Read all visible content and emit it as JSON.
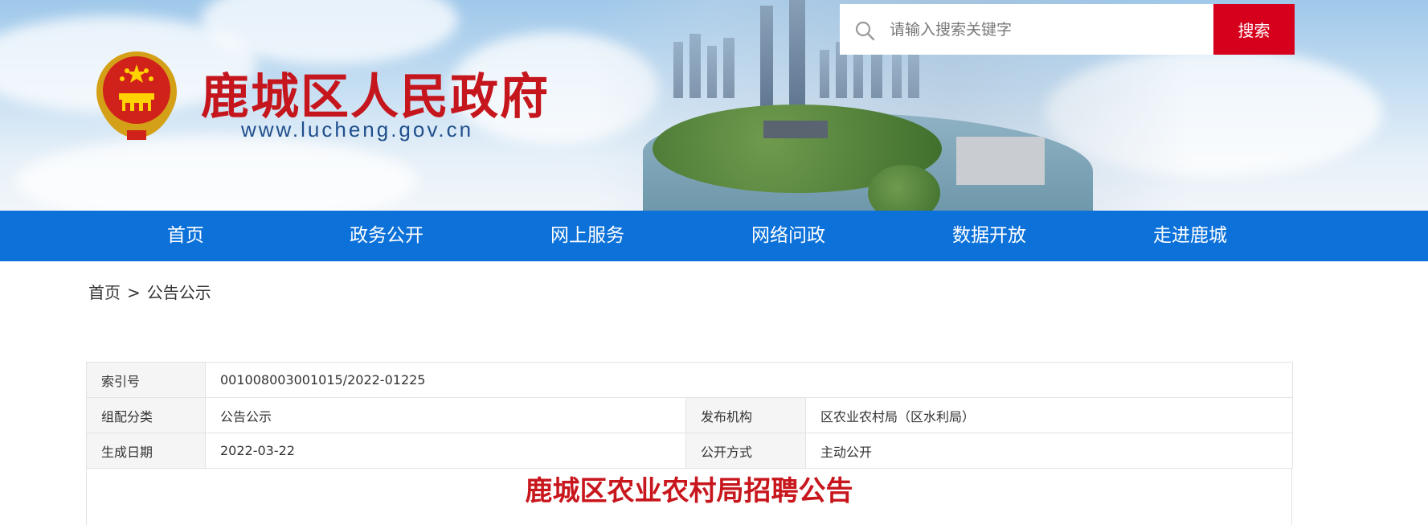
{
  "header": {
    "site_title": "鹿城区人民政府",
    "site_url": "www.lucheng.gov.cn",
    "search": {
      "placeholder": "请输入搜索关键字",
      "button_label": "搜索"
    }
  },
  "nav": {
    "items": [
      {
        "label": "首页"
      },
      {
        "label": "政务公开"
      },
      {
        "label": "网上服务"
      },
      {
        "label": "网络问政"
      },
      {
        "label": "数据开放"
      },
      {
        "label": "走进鹿城"
      }
    ]
  },
  "breadcrumb": {
    "home": "首页",
    "separator": ">",
    "current": "公告公示"
  },
  "meta": {
    "index_label": "索引号",
    "index_value": "001008003001015/2022-01225",
    "category_label": "组配分类",
    "category_value": "公告公示",
    "publisher_label": "发布机构",
    "publisher_value": "区农业农村局（区水利局）",
    "date_label": "生成日期",
    "date_value": "2022-03-22",
    "disclosure_label": "公开方式",
    "disclosure_value": "主动公开"
  },
  "article": {
    "title": "鹿城区农业农村局招聘公告"
  },
  "colors": {
    "nav": "#0c71d9",
    "accent": "#d6001c",
    "title_red": "#c5161d",
    "url_blue": "#1f4e8c"
  },
  "icons": {
    "emblem": "national-emblem-icon",
    "search": "search-icon"
  }
}
